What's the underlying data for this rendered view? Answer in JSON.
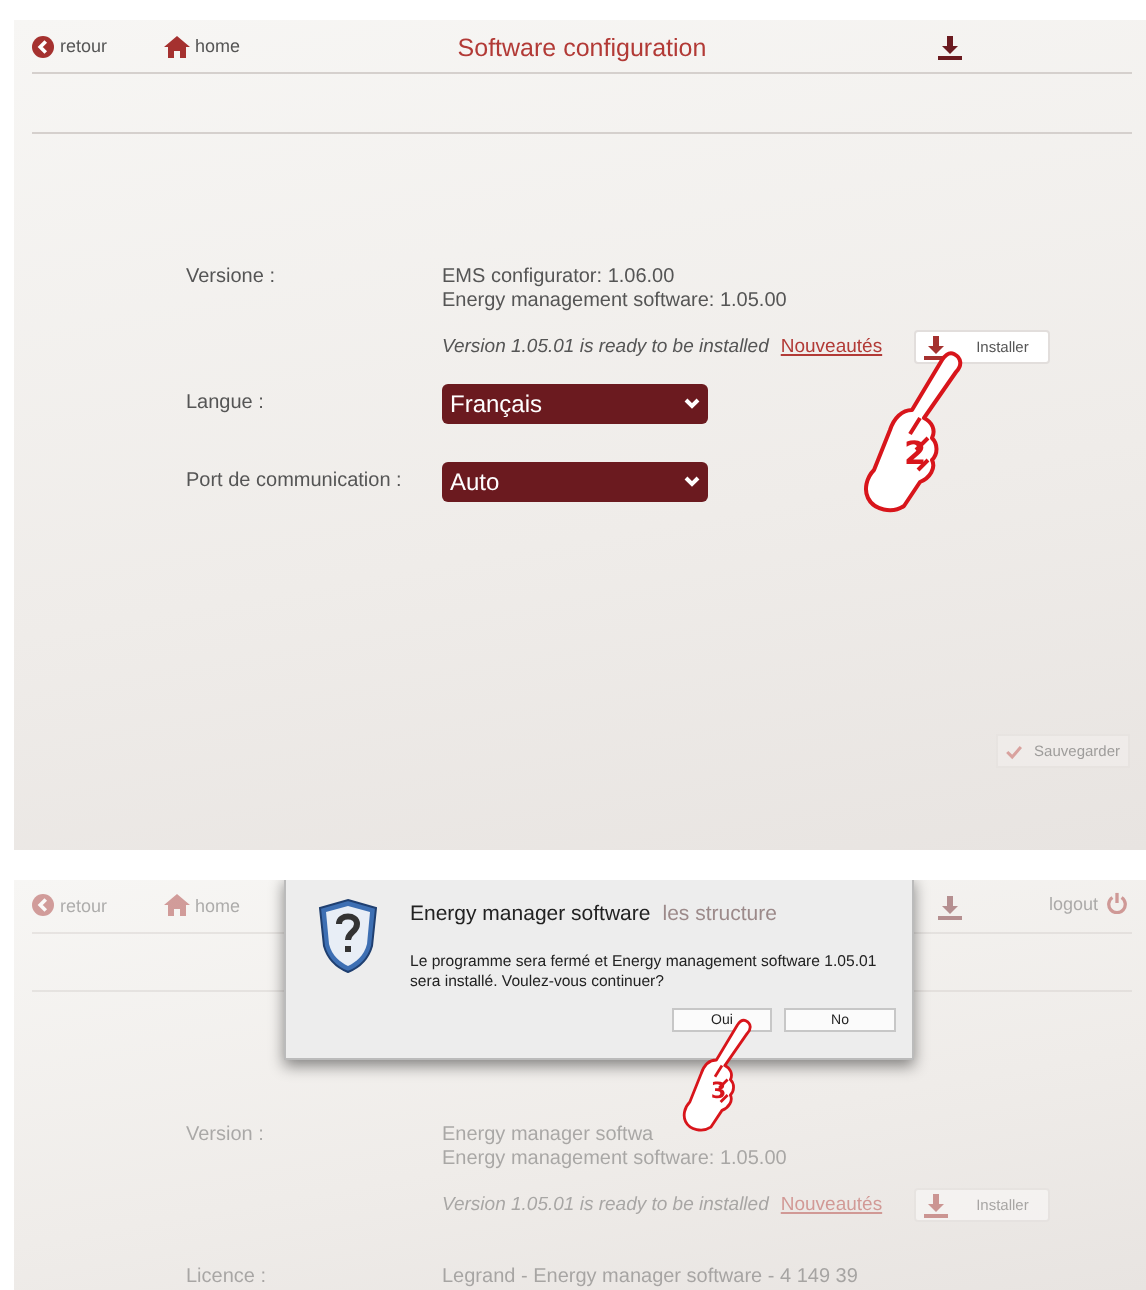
{
  "screens": [
    {
      "nav": [
        {
          "kind": "back",
          "label": "retour"
        },
        {
          "kind": "home",
          "label": "home"
        }
      ],
      "title": "Software configuration",
      "rows": [
        {
          "kind": "info",
          "label": "Versione :",
          "lines": [
            "EMS configurator: 1.06.00",
            "Energy management software: 1.05.00"
          ],
          "update": {
            "message": "Version 1.05.01 is ready to be installed",
            "link": "Nouveautés",
            "button": "Installer"
          }
        },
        {
          "kind": "select",
          "label": "Langue :",
          "value": "Français"
        },
        {
          "kind": "select",
          "label": "Port de communication :",
          "value": "Auto"
        }
      ],
      "save_button": {
        "label": "Sauvegarder",
        "disabled": true
      },
      "callout": {
        "number": "2"
      }
    },
    {
      "nav": [
        {
          "kind": "back",
          "label": "retour"
        },
        {
          "kind": "home",
          "label": "home"
        }
      ],
      "logout": "logout",
      "dialog": {
        "title": "Energy manager software",
        "behind_title": "les structure",
        "message": "Le programme sera fermé et Energy management software 1.05.01 sera installé. Voulez-vous continuer?",
        "buttons": [
          "Oui",
          "No"
        ]
      },
      "rows": [
        {
          "kind": "info",
          "label": "Version :",
          "lines": [
            "Energy manager softwa",
            "Energy management software: 1.05.00"
          ],
          "update": {
            "message": "Version 1.05.01 is ready to be installed",
            "link": "Nouveautés",
            "button": "Installer"
          }
        },
        {
          "kind": "text",
          "label": "Licence :",
          "value": "Legrand - Energy manager software - 4 149 39"
        }
      ],
      "callout": {
        "number": "3"
      }
    }
  ]
}
